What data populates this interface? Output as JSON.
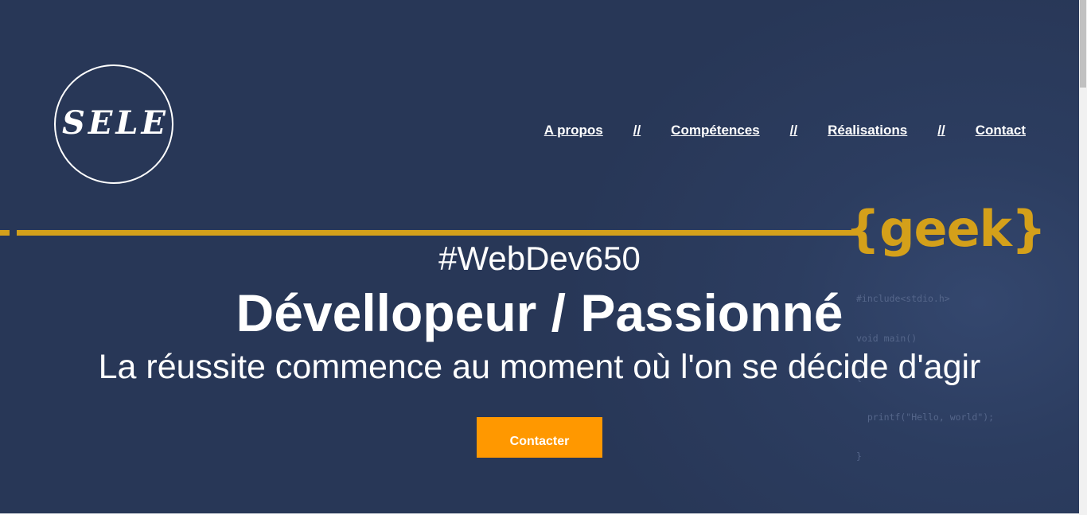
{
  "logo": {
    "text": "SELE"
  },
  "nav": {
    "items": [
      "A propos",
      "Compétences",
      "Réalisations",
      "Contact"
    ],
    "separator": "//"
  },
  "badge": {
    "text": "{geek}",
    "code_lines": [
      "#include<stdio.h>",
      "void main()",
      "{",
      "  printf(\"Hello, world\");",
      "}"
    ]
  },
  "hero": {
    "hashtag": "#WebDev650",
    "title": "Dévellopeur / Passionné",
    "tagline": "La réussite commence au moment où l'on se décide d'agir",
    "cta_label": "Contacter"
  },
  "colors": {
    "background": "#283757",
    "accent_line": "#d4a01a",
    "button": "#ff9800",
    "text": "#ffffff"
  }
}
